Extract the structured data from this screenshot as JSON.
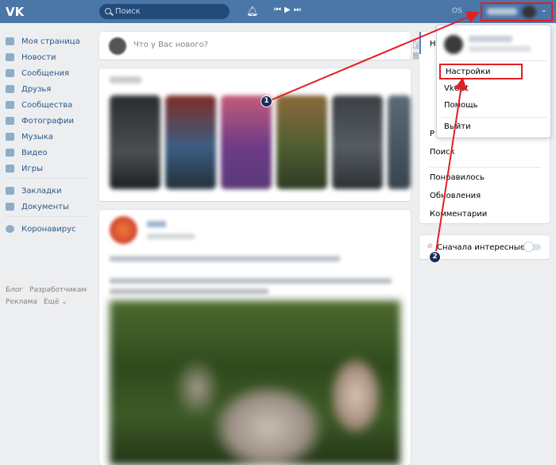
{
  "header": {
    "logo_label": "VK",
    "search_placeholder": "Поиск",
    "os_label": "OS"
  },
  "left_menu": [
    {
      "label": "Моя страница",
      "icon": "home-icon"
    },
    {
      "label": "Новости",
      "icon": "news-icon"
    },
    {
      "label": "Сообщения",
      "icon": "messages-icon"
    },
    {
      "label": "Друзья",
      "icon": "friends-icon"
    },
    {
      "label": "Сообщества",
      "icon": "communities-icon"
    },
    {
      "label": "Фотографии",
      "icon": "photos-icon"
    },
    {
      "label": "Музыка",
      "icon": "music-icon"
    },
    {
      "label": "Видео",
      "icon": "video-icon"
    },
    {
      "label": "Игры",
      "icon": "games-icon"
    }
  ],
  "left_menu_2": [
    {
      "label": "Закладки",
      "icon": "bookmarks-icon"
    },
    {
      "label": "Документы",
      "icon": "documents-icon"
    }
  ],
  "left_menu_3": [
    {
      "label": "Коронавирус",
      "icon": "coronavirus-icon"
    }
  ],
  "footer": {
    "blog": "Блог",
    "developers": "Разработчикам",
    "ads": "Реклама",
    "more": "Ещё ⌄"
  },
  "composer": {
    "placeholder": "Что у Вас нового?"
  },
  "right_menu": {
    "selected_initial": "Н",
    "item_r": "Р",
    "search": "Поиск",
    "liked": "Понравилось",
    "updates": "Обновления",
    "comments": "Комментарии",
    "interesting_first": "Сначала интересные"
  },
  "dropdown": {
    "settings": "Настройки",
    "vkopt": "VkOpt",
    "help": "Помощь",
    "logout": "Выйти"
  },
  "annotations": {
    "step1": "1",
    "step2": "2",
    "color": "#e31e24"
  }
}
